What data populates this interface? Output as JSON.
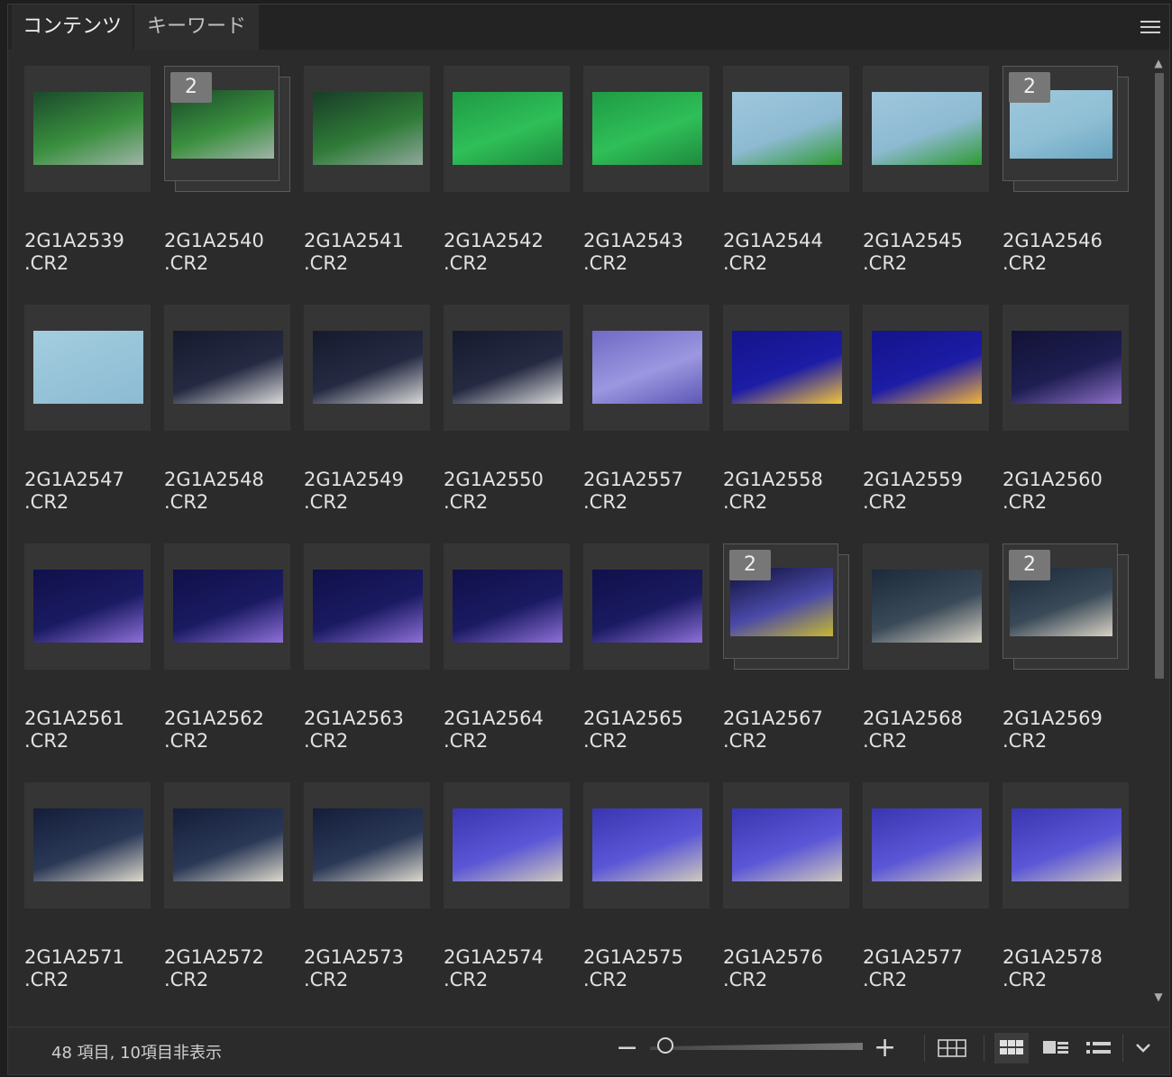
{
  "tabs": [
    "コンテンツ",
    "キーワード"
  ],
  "menu_icon": "hamburger-menu-icon",
  "items": [
    {
      "name": "2G1A2539\n.CR2",
      "stack": null,
      "colors": [
        "#1b4a2c",
        "#3a8f3e",
        "#9fb3a8"
      ]
    },
    {
      "name": "2G1A2540\n.CR2",
      "stack": "2",
      "colors": [
        "#1b4a2c",
        "#3a8f3e",
        "#9fb3a8"
      ]
    },
    {
      "name": "2G1A2541\n.CR2",
      "stack": null,
      "colors": [
        "#183d28",
        "#2f7a37",
        "#8ea79b"
      ]
    },
    {
      "name": "2G1A2542\n.CR2",
      "stack": null,
      "colors": [
        "#1f9a45",
        "#2fbf58",
        "#1f8a3e"
      ]
    },
    {
      "name": "2G1A2543\n.CR2",
      "stack": null,
      "colors": [
        "#1f9a45",
        "#2fbf58",
        "#1f8a3e"
      ]
    },
    {
      "name": "2G1A2544\n.CR2",
      "stack": null,
      "colors": [
        "#9fc7dc",
        "#8dbad2",
        "#2f9a33"
      ]
    },
    {
      "name": "2G1A2545\n.CR2",
      "stack": null,
      "colors": [
        "#9fc7dc",
        "#8dbad2",
        "#2f9a33"
      ]
    },
    {
      "name": "2G1A2546\n.CR2",
      "stack": "2",
      "colors": [
        "#9fc7dc",
        "#8fbfd4",
        "#6aa6c2"
      ]
    },
    {
      "name": "2G1A2547\n.CR2",
      "stack": null,
      "colors": [
        "#a4cddf",
        "#96c3d8",
        "#8dbbd2"
      ]
    },
    {
      "name": "2G1A2548\n.CR2",
      "stack": null,
      "colors": [
        "#161a2e",
        "#252a42",
        "#dadada"
      ]
    },
    {
      "name": "2G1A2549\n.CR2",
      "stack": null,
      "colors": [
        "#161a2e",
        "#252a42",
        "#dadada"
      ]
    },
    {
      "name": "2G1A2550\n.CR2",
      "stack": null,
      "colors": [
        "#161a2e",
        "#252a42",
        "#dadada"
      ]
    },
    {
      "name": "2G1A2557\n.CR2",
      "stack": null,
      "colors": [
        "#6f6ac4",
        "#9c97e0",
        "#5d58b5"
      ]
    },
    {
      "name": "2G1A2558\n.CR2",
      "stack": null,
      "colors": [
        "#14148a",
        "#1c1ca6",
        "#f2c43a"
      ]
    },
    {
      "name": "2G1A2559\n.CR2",
      "stack": null,
      "colors": [
        "#14148a",
        "#1c1ca6",
        "#f2b43a"
      ]
    },
    {
      "name": "2G1A2560\n.CR2",
      "stack": null,
      "colors": [
        "#121236",
        "#1e1e52",
        "#8e6fc8"
      ]
    },
    {
      "name": "2G1A2561\n.CR2",
      "stack": null,
      "colors": [
        "#10104a",
        "#1a1a62",
        "#8e6fd8"
      ]
    },
    {
      "name": "2G1A2562\n.CR2",
      "stack": null,
      "colors": [
        "#10104a",
        "#1a1a62",
        "#8e6fd8"
      ]
    },
    {
      "name": "2G1A2563\n.CR2",
      "stack": null,
      "colors": [
        "#10104a",
        "#1a1a62",
        "#8e6fd8"
      ]
    },
    {
      "name": "2G1A2564\n.CR2",
      "stack": null,
      "colors": [
        "#10104a",
        "#1a1a62",
        "#8e6fd8"
      ]
    },
    {
      "name": "2G1A2565\n.CR2",
      "stack": null,
      "colors": [
        "#10104a",
        "#1a1a62",
        "#8e6fd8"
      ]
    },
    {
      "name": "2G1A2567\n.CR2",
      "stack": "2",
      "colors": [
        "#0f0f3a",
        "#4a4aa8",
        "#c8b830"
      ]
    },
    {
      "name": "2G1A2568\n.CR2",
      "stack": null,
      "colors": [
        "#1c2a3a",
        "#3a4a58",
        "#d8d2c4"
      ]
    },
    {
      "name": "2G1A2569\n.CR2",
      "stack": "2",
      "colors": [
        "#1c2a3a",
        "#3a4a58",
        "#d8d2c4"
      ]
    },
    {
      "name": "2G1A2571\n.CR2",
      "stack": null,
      "colors": [
        "#141e3a",
        "#2a3856",
        "#dcd8cc"
      ]
    },
    {
      "name": "2G1A2572\n.CR2",
      "stack": null,
      "colors": [
        "#141e3a",
        "#2a3856",
        "#dcd8cc"
      ]
    },
    {
      "name": "2G1A2573\n.CR2",
      "stack": null,
      "colors": [
        "#141e3a",
        "#2a3856",
        "#dcd8cc"
      ]
    },
    {
      "name": "2G1A2574\n.CR2",
      "stack": null,
      "colors": [
        "#3a36b0",
        "#5a56d6",
        "#cfc9bd"
      ]
    },
    {
      "name": "2G1A2575\n.CR2",
      "stack": null,
      "colors": [
        "#3a36b0",
        "#5a56d6",
        "#cfc9bd"
      ]
    },
    {
      "name": "2G1A2576\n.CR2",
      "stack": null,
      "colors": [
        "#3a36b0",
        "#5a56d6",
        "#cfc9bd"
      ]
    },
    {
      "name": "2G1A2577\n.CR2",
      "stack": null,
      "colors": [
        "#3a36b0",
        "#5a56d6",
        "#cfc9bd"
      ]
    },
    {
      "name": "2G1A2578\n.CR2",
      "stack": null,
      "colors": [
        "#3a36b0",
        "#5a56d6",
        "#cfc9bd"
      ]
    }
  ],
  "status": {
    "text": "48 項目, 10項目非表示",
    "zoom_minus_icon": "zoom-out-icon",
    "zoom_plus_icon": "zoom-in-icon",
    "zoom_level": 0.05
  },
  "view_modes": [
    {
      "name": "grid-view-icon",
      "active": false
    },
    {
      "name": "thumbnail-view-icon",
      "active": true
    },
    {
      "name": "details-view-icon",
      "active": false
    },
    {
      "name": "list-view-icon",
      "active": false
    }
  ],
  "view_menu_icon": "chevron-down-icon"
}
